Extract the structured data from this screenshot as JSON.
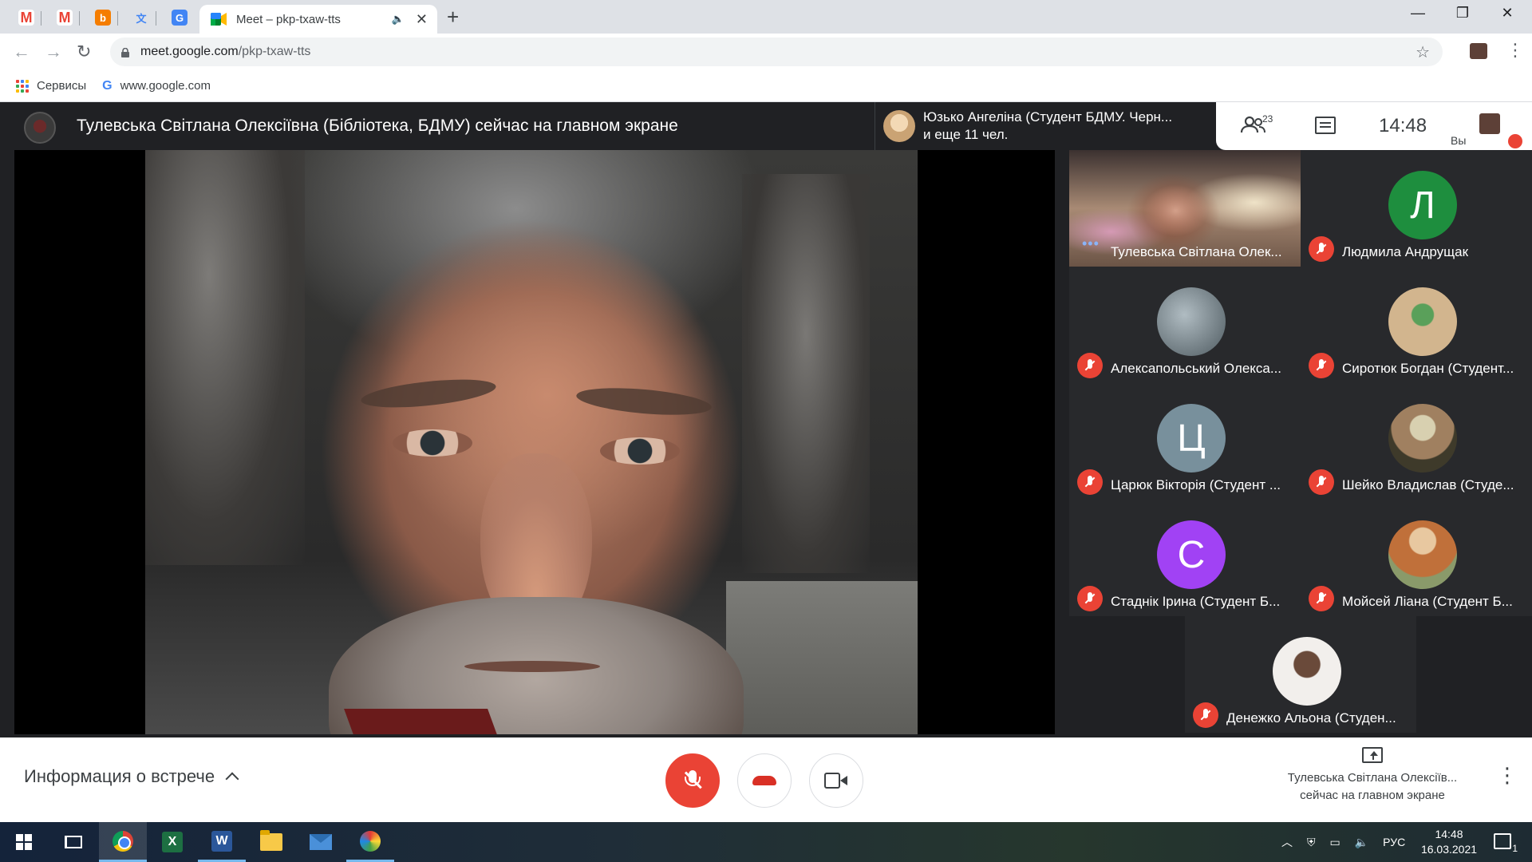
{
  "browser": {
    "mini_tabs": [
      {
        "icon": "gmail-icon",
        "color": "#ea4335",
        "letter": "M"
      },
      {
        "icon": "gmail-icon",
        "color": "#ea4335",
        "letter": "M"
      },
      {
        "icon": "blogger-icon",
        "color": "#f57d00",
        "letter": "b"
      },
      {
        "icon": "translate-icon",
        "color": "#4285f4",
        "letter": "文"
      },
      {
        "icon": "google-translate-icon",
        "color": "#4285f4",
        "letter": "G"
      }
    ],
    "active_tab": {
      "title": "Meet – pkp-txaw-tts",
      "icon": "google-meet-icon"
    },
    "address": {
      "domain": "meet.google.com",
      "path": "/pkp-txaw-tts"
    },
    "bookmarks": [
      {
        "label": "Сервисы",
        "icon": "apps-grid-icon"
      },
      {
        "label": "www.google.com",
        "icon": "google-icon"
      }
    ],
    "window_controls": [
      "—",
      "❐",
      "✕"
    ]
  },
  "meet": {
    "presenting_title": "Тулевська Світлана Олексіївна (Бібліотека, БДМУ) сейчас на главном экране",
    "notification": {
      "line1": "Юзько Ангеліна (Студент БДМУ. Черн...",
      "line2": "и еще 11 чел."
    },
    "participant_count": "23",
    "clock": "14:48",
    "you_label": "Вы",
    "participants": [
      {
        "name": "Тулевська Світлана Олек...",
        "type": "video",
        "speaking": true
      },
      {
        "name": "Людмила Андрущак",
        "type": "letter",
        "letter": "Л",
        "color": "#1e8e3e",
        "muted": true
      },
      {
        "name": "Алексапольський Олекса...",
        "type": "photo",
        "color": "#6f7f86",
        "muted": true
      },
      {
        "name": "Сиротюк Богдан (Студент...",
        "type": "photo",
        "color": "#c4a27c",
        "muted": true
      },
      {
        "name": "Царюк Вікторія (Студент ...",
        "type": "letter",
        "letter": "Ц",
        "color": "#78909c",
        "muted": true
      },
      {
        "name": "Шейко Владислав (Студе...",
        "type": "photo",
        "color": "#6d6a4a",
        "muted": true
      },
      {
        "name": "Стаднік Ірина (Студент Б...",
        "type": "letter",
        "letter": "С",
        "color": "#a142f4",
        "muted": true
      },
      {
        "name": "Мойсей Ліана (Студент Б...",
        "type": "photo",
        "color": "#c98b5e",
        "muted": true
      },
      {
        "name": "Денежко Альона (Студен...",
        "type": "photo",
        "color": "#e8e4e0",
        "muted": true
      }
    ],
    "bottom": {
      "meeting_info": "Информация о встрече",
      "presenter_line1": "Тулевська Світлана Олексіїв...",
      "presenter_line2": "сейчас на главном экране"
    }
  },
  "taskbar": {
    "tray_lang": "РУС",
    "time": "14:48",
    "date": "16.03.2021",
    "notifications": "1"
  }
}
